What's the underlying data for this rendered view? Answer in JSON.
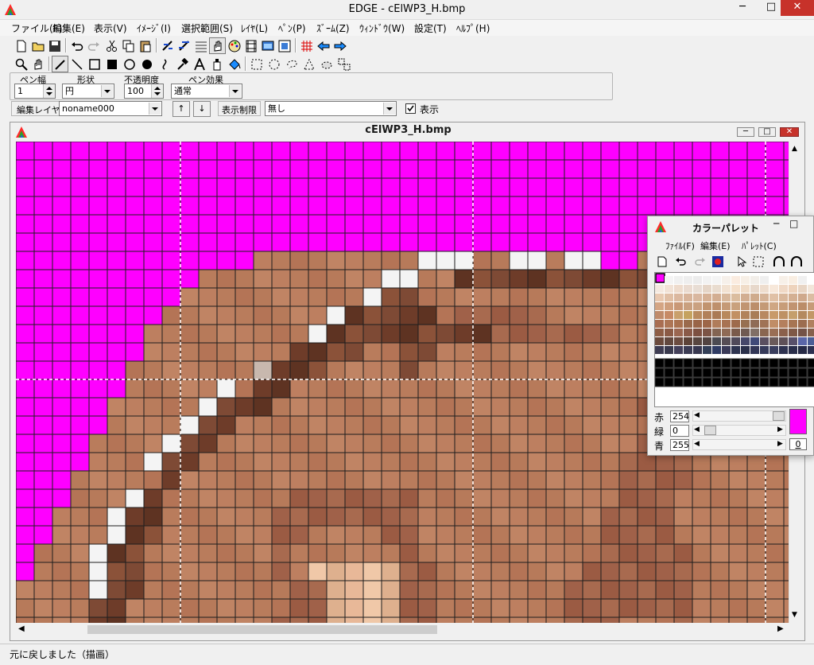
{
  "app": {
    "title": "EDGE - cElWP3_H.bmp",
    "window_controls": {
      "minimize": "─",
      "maximize": "□",
      "close": "✕"
    }
  },
  "menu": [
    {
      "label": "ファイル(F)"
    },
    {
      "label": "編集(E)"
    },
    {
      "label": "表示(V)"
    },
    {
      "label": "ｲﾒｰｼﾞ(I)"
    },
    {
      "label": "選択範囲(S)"
    },
    {
      "label": "ﾚｲﾔ(L)"
    },
    {
      "label": "ﾍﾟﾝ(P)"
    },
    {
      "label": "ｽﾞｰﾑ(Z)"
    },
    {
      "label": "ｳｨﾝﾄﾞｳ(W)"
    },
    {
      "label": "設定(T)"
    },
    {
      "label": "ﾍﾙﾌﾟ(H)"
    }
  ],
  "toolbar1": [
    "new-file-icon",
    "open-folder-icon",
    "save-icon",
    "undo-icon",
    "redo-icon",
    "cut-icon",
    "copy-icon",
    "paste-icon",
    "flip-horizontal-icon",
    "flip-vertical-icon",
    "grid-lines-icon",
    "hand-select-icon",
    "palette-icon",
    "film-icon",
    "preview-window-icon",
    "screen-capture-icon",
    "grid-toggle-icon",
    "back-arrow-icon",
    "forward-arrow-icon"
  ],
  "toolbar2": [
    "zoom-icon",
    "hand-scroll-icon",
    "pen-icon",
    "line-icon",
    "rectangle-icon",
    "filled-rectangle-icon",
    "circle-icon",
    "filled-circle-icon",
    "curve-icon",
    "hammer-icon",
    "text-icon",
    "spray-icon",
    "fill-bucket-icon",
    "rect-select-icon",
    "ellipse-select-icon",
    "lasso-select-icon",
    "polygon-select-icon",
    "auto-select-icon",
    "swap-select-icon"
  ],
  "pen_options": {
    "width_label": "ペン幅",
    "width_value": "1",
    "shape_label": "形状",
    "shape_value": "円",
    "opacity_label": "不透明度",
    "opacity_value": "100",
    "effect_label": "ペン効果",
    "effect_value": "通常"
  },
  "layer_bar": {
    "edit_layer_label": "編集レイヤ",
    "layer_value": "noname000",
    "up_label": "↑",
    "down_label": "↓",
    "display_limit_label": "表示制限",
    "display_limit_value": "無し",
    "show_label": "表示",
    "show_checked": true
  },
  "document": {
    "title": "cElWP3_H.bmp"
  },
  "palette": {
    "title": "カラーパレット",
    "menu": [
      "ﾌｧｲﾙ(F)",
      "編集(E)",
      "ﾊﾟﾚｯﾄ(C)"
    ],
    "red_label": "赤",
    "red_value": "254",
    "green_label": "緑",
    "green_value": "0",
    "blue_label": "青",
    "blue_value": "255",
    "index_value": "0",
    "current_color": "#fe00ff"
  },
  "status": {
    "text": "元に戻しました（描画）"
  },
  "colors": {
    "magenta": "#fe00ff",
    "grid_line": "#1e1e1e"
  }
}
